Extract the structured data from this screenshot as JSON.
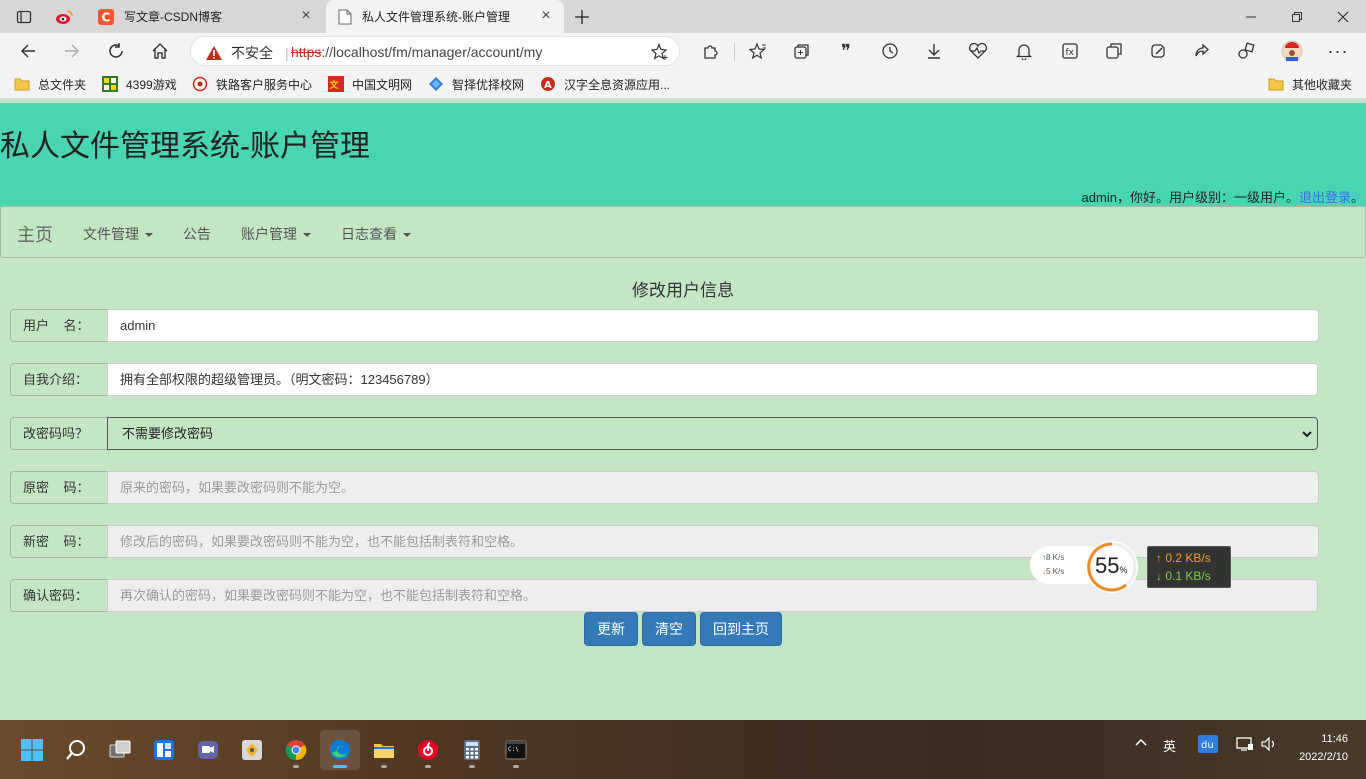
{
  "browser": {
    "tabs": [
      {
        "title": "写文章-CSDN博客",
        "active": false
      },
      {
        "title": "私人文件管理系统-账户管理",
        "active": true
      }
    ],
    "security_label": "不安全",
    "url_scheme": "https",
    "url_rest": "://localhost/fm/manager/account/my",
    "bookmarks": [
      {
        "label": "总文件夹",
        "icon": "folder-icon"
      },
      {
        "label": "4399游戏",
        "icon": "4399-icon"
      },
      {
        "label": "铁路客户服务中心",
        "icon": "railway-icon"
      },
      {
        "label": "中国文明网",
        "icon": "civilization-icon"
      },
      {
        "label": "智择优择校网",
        "icon": "school-icon"
      },
      {
        "label": "汉字全息资源应用...",
        "icon": "hanzi-icon"
      }
    ],
    "other_bookmarks": "其他收藏夹"
  },
  "page": {
    "site_title": "私人文件管理系统-账户管理",
    "user_greeting": "admin，你好。用户级别：一级用户。",
    "logout_link": "退出登录",
    "logout_suffix": "。",
    "menu": {
      "brand": "主页",
      "items": [
        {
          "label": "文件管理",
          "dropdown": true
        },
        {
          "label": "公告",
          "dropdown": false
        },
        {
          "label": "账户管理",
          "dropdown": true
        },
        {
          "label": "日志查看",
          "dropdown": true
        }
      ]
    },
    "form": {
      "title": "修改用户信息",
      "username": {
        "label": "用户    名：",
        "value": "admin"
      },
      "intro": {
        "label": "自我介绍：",
        "value": "拥有全部权限的超级管理员。（明文密码：123456789）"
      },
      "change_pwd": {
        "label": "改密码吗？",
        "selected": "不需要修改密码"
      },
      "old_pwd": {
        "label": "原密    码：",
        "placeholder": "原来的密码，如果要改密码则不能为空。"
      },
      "new_pwd": {
        "label": "新密    码：",
        "placeholder": "修改后的密码，如果要改密码则不能为空，也不能包括制表符和空格。"
      },
      "confirm_pwd": {
        "label": "确认密码：",
        "placeholder": "再次确认的密码，如果要改密码则不能为空，也不能包括制表符和空格。"
      },
      "buttons": {
        "update": "更新",
        "clear": "清空",
        "home": "回到主页"
      }
    }
  },
  "speed_widget": {
    "up_small": "8   K/s",
    "down_small": "5   K/s",
    "percent": "55",
    "percent_unit": "%",
    "upload": "↑ 0.2 KB/s",
    "download": "↓ 0.1 KB/s"
  },
  "taskbar": {
    "ime": "英",
    "time": "11:46",
    "date": "2022/2/10"
  },
  "colors": {
    "header": "#49d4b2",
    "body": "#c4e6c5",
    "button": "#337ab7",
    "link": "#3a6fd8"
  }
}
